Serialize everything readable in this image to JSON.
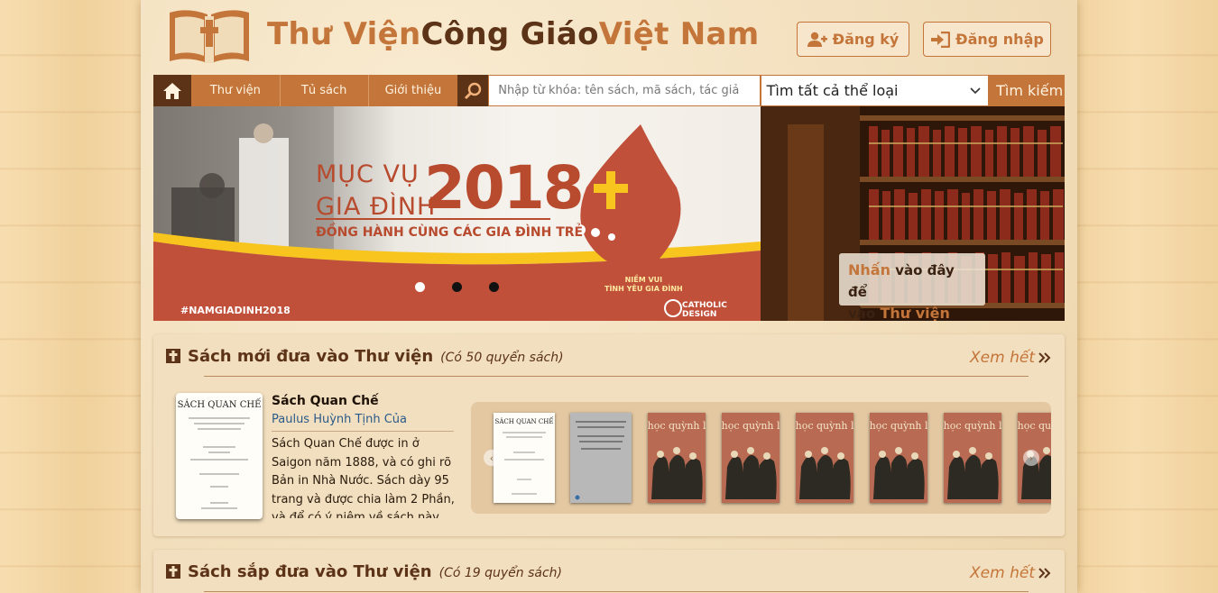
{
  "header": {
    "brand_part1": "Thư Viện",
    "brand_part2": "Công Giáo",
    "brand_part3": "Việt Nam",
    "register_label": "Đăng ký",
    "login_label": "Đăng nhập"
  },
  "nav": {
    "items": [
      {
        "label": "Thư viện"
      },
      {
        "label": "Tủ sách"
      },
      {
        "label": "Giới thiệu"
      }
    ],
    "search_placeholder": "Nhập từ khóa: tên sách, mã sách, tác giả",
    "category_selected": "Tìm tất cả thể loại",
    "search_button": "Tìm kiếm"
  },
  "banner": {
    "title_line1": "MỤC VỤ",
    "title_line2": "GIA ĐÌNH",
    "year": "2018",
    "subtitle": "ĐỒNG HÀNH CÙNG CÁC GIA ĐÌNH TRẺ",
    "flame_text_1": "NIỀM VUI",
    "flame_text_2": "TÌNH YÊU GIA ĐÌNH",
    "hashtag": "#NAMGIADINH2018",
    "credit": "CATHOLIC DESIGN",
    "active_slide": 1,
    "slide_count": 3
  },
  "library_cta": {
    "highlight1": "Nhấn",
    "text1": " vào đây để",
    "text2": "vào ",
    "highlight2": "Thư viện"
  },
  "sections": [
    {
      "title": "Sách mới đưa vào Thư viện",
      "count": "(Có 50 quyển sách)",
      "see_all": "Xem hết",
      "featured": {
        "cover_title": "SÁCH QUAN CHẾ",
        "title": "Sách Quan Chế",
        "author": "Paulus Huỳnh Tịnh Của",
        "description": "Sách Quan Chế được in ở Saigon năm 1888, và có ghi rõ Bản in Nhà Nước. Sách dày 95 trang và được chia làm 2 Phần, và để có ý niệm về sách này,"
      },
      "thumbnails": [
        {
          "kind": "white-doc",
          "title": "SÁCH QUAN CHẾ"
        },
        {
          "kind": "grey-doc",
          "title": ""
        },
        {
          "kind": "painting",
          "title": "âu học quỳnh lâm"
        },
        {
          "kind": "painting",
          "title": "âu học quỳnh lâm"
        },
        {
          "kind": "painting",
          "title": "âu học quỳnh lâm"
        },
        {
          "kind": "painting",
          "title": "âu học quỳnh lâm"
        },
        {
          "kind": "painting",
          "title": "âu học quỳnh lâm"
        },
        {
          "kind": "painting",
          "title": "âu học quỳnh lâm"
        }
      ]
    },
    {
      "title": "Sách sắp đưa vào Thư viện",
      "count": "(Có 19 quyển sách)",
      "see_all": "Xem hết"
    }
  ],
  "colors": {
    "accent": "#c4753a",
    "dark_brown": "#5c3317",
    "section_bg": "#f2dfbf"
  }
}
